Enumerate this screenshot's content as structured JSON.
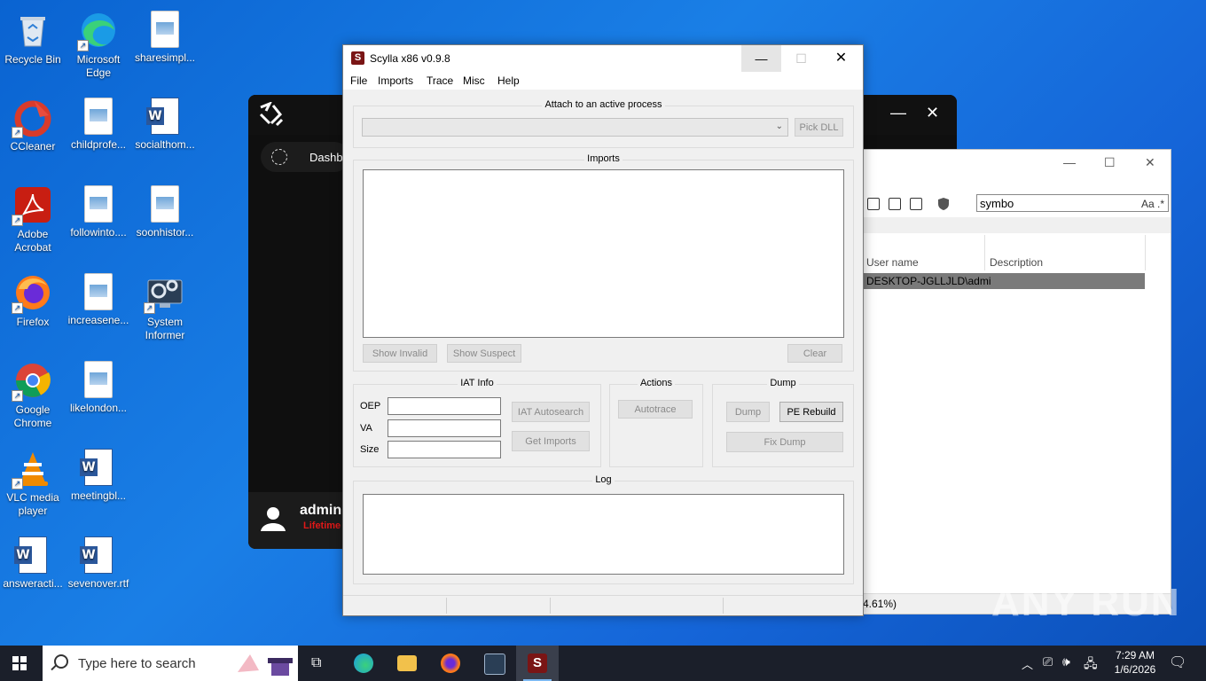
{
  "desktop": {
    "icons": [
      {
        "label": "Recycle Bin"
      },
      {
        "label": "Microsoft Edge"
      },
      {
        "label": "sharesimpl..."
      },
      {
        "label": "CCleaner"
      },
      {
        "label": "childprofe..."
      },
      {
        "label": "socialthom..."
      },
      {
        "label": "Adobe Acrobat"
      },
      {
        "label": "followinto...."
      },
      {
        "label": "soonhistor..."
      },
      {
        "label": "Firefox"
      },
      {
        "label": "increasene..."
      },
      {
        "label": "System Informer"
      },
      {
        "label": "Google Chrome"
      },
      {
        "label": "likelondon..."
      },
      {
        "label": "VLC media player"
      },
      {
        "label": "meetingbl..."
      },
      {
        "label": "answeracti..."
      },
      {
        "label": "sevenover.rtf"
      }
    ]
  },
  "dark_app": {
    "nav_label": "Dashb",
    "user_name": "admin",
    "user_tier": "Lifetime"
  },
  "proc_window": {
    "search_value": "symbo",
    "search_tools": "Aa .* ",
    "col_user": "User name",
    "col_desc": "Description",
    "row_user": "DESKTOP-JGLLJLD\\admi",
    "status": "4.61%)"
  },
  "scylla": {
    "title": "Scylla x86 v0.9.8",
    "menu": {
      "file": "File",
      "imports": "Imports",
      "trace": "Trace",
      "misc": "Misc",
      "help": "Help"
    },
    "attach_label": "Attach to an active process",
    "pick_dll": "Pick DLL",
    "imports_label": "Imports",
    "show_invalid": "Show Invalid",
    "show_suspect": "Show Suspect",
    "clear": "Clear",
    "iat_label": "IAT Info",
    "oep": "OEP",
    "va": "VA",
    "size": "Size",
    "iat_autosearch": "IAT Autosearch",
    "get_imports": "Get Imports",
    "actions_label": "Actions",
    "autotrace": "Autotrace",
    "dump_label": "Dump",
    "dump": "Dump",
    "pe_rebuild": "PE Rebuild",
    "fix_dump": "Fix Dump",
    "log_label": "Log"
  },
  "taskbar": {
    "search_placeholder": "Type here to search",
    "time": "7:29 AM",
    "date": "1/6/2026"
  },
  "watermark": "ANY RUN"
}
